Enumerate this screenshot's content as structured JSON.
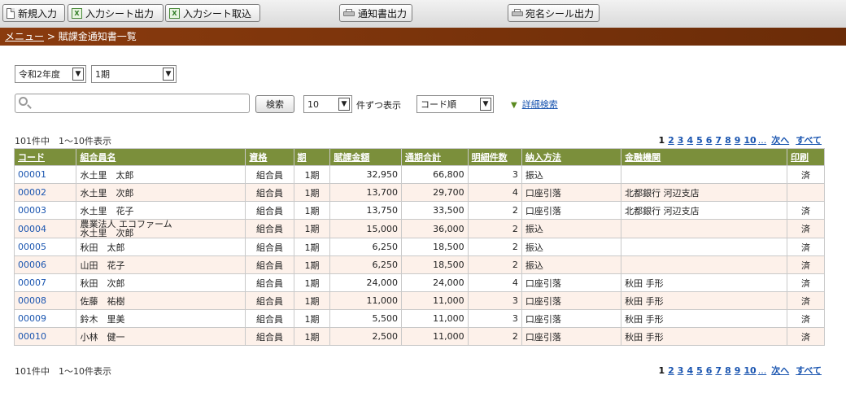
{
  "toolbar": {
    "new_entry": "新規入力",
    "sheet_output": "入力シート出力",
    "sheet_import": "入力シート取込",
    "notice_output": "通知書出力",
    "label_output": "宛名シール出力"
  },
  "breadcrumb": {
    "menu": "メニュー",
    "separator": " > ",
    "current": "賦課金通知書一覧"
  },
  "filters": {
    "year": "令和2年度",
    "term": "1期",
    "search_placeholder": "",
    "search_button": "検索",
    "per_page": "10",
    "per_page_label": "件ずつ表示",
    "order": "コード順",
    "advanced_search": "詳細検索"
  },
  "summary": {
    "top": "101件中　1〜10件表示",
    "bottom": "101件中　1〜10件表示"
  },
  "pager": {
    "current": "1",
    "pages": [
      "2",
      "3",
      "4",
      "5",
      "6",
      "7",
      "8",
      "9",
      "10"
    ],
    "ellipsis": "...",
    "next": "次へ",
    "all": "すべて"
  },
  "table": {
    "headers": [
      "コード",
      "組合員名",
      "資格",
      "期",
      "賦課金額",
      "通期合計",
      "明細件数",
      "納入方法",
      "金融機関",
      "印刷"
    ],
    "rows": [
      {
        "code": "00001",
        "name": "水土里　太郎",
        "qual": "組合員",
        "term": "1期",
        "amount": "32,950",
        "total": "66,800",
        "count": "3",
        "method": "振込",
        "bank": "",
        "print": "済"
      },
      {
        "code": "00002",
        "name": "水土里　次郎",
        "qual": "組合員",
        "term": "1期",
        "amount": "13,700",
        "total": "29,700",
        "count": "4",
        "method": "口座引落",
        "bank": "北都銀行 河辺支店",
        "print": ""
      },
      {
        "code": "00003",
        "name": "水土里　花子",
        "qual": "組合員",
        "term": "1期",
        "amount": "13,750",
        "total": "33,500",
        "count": "2",
        "method": "口座引落",
        "bank": "北都銀行 河辺支店",
        "print": "済"
      },
      {
        "code": "00004",
        "name": "農業法人 エコファーム\n水土里　次郎",
        "qual": "組合員",
        "term": "1期",
        "amount": "15,000",
        "total": "36,000",
        "count": "2",
        "method": "振込",
        "bank": "",
        "print": "済"
      },
      {
        "code": "00005",
        "name": "秋田　太郎",
        "qual": "組合員",
        "term": "1期",
        "amount": "6,250",
        "total": "18,500",
        "count": "2",
        "method": "振込",
        "bank": "",
        "print": "済"
      },
      {
        "code": "00006",
        "name": "山田　花子",
        "qual": "組合員",
        "term": "1期",
        "amount": "6,250",
        "total": "18,500",
        "count": "2",
        "method": "振込",
        "bank": "",
        "print": "済"
      },
      {
        "code": "00007",
        "name": "秋田　次郎",
        "qual": "組合員",
        "term": "1期",
        "amount": "24,000",
        "total": "24,000",
        "count": "4",
        "method": "口座引落",
        "bank": "秋田 手形",
        "print": "済"
      },
      {
        "code": "00008",
        "name": "佐藤　祐樹",
        "qual": "組合員",
        "term": "1期",
        "amount": "11,000",
        "total": "11,000",
        "count": "3",
        "method": "口座引落",
        "bank": "秋田 手形",
        "print": "済"
      },
      {
        "code": "00009",
        "name": "鈴木　里美",
        "qual": "組合員",
        "term": "1期",
        "amount": "5,500",
        "total": "11,000",
        "count": "3",
        "method": "口座引落",
        "bank": "秋田 手形",
        "print": "済"
      },
      {
        "code": "00010",
        "name": "小林　健一",
        "qual": "組合員",
        "term": "1期",
        "amount": "2,500",
        "total": "11,000",
        "count": "2",
        "method": "口座引落",
        "bank": "秋田 手形",
        "print": "済"
      }
    ]
  },
  "colors": {
    "header_bg": "#7b8f3b",
    "crumb_bg": "#7a3410",
    "alt_row": "#fdf1ea",
    "link": "#1a55b0"
  }
}
